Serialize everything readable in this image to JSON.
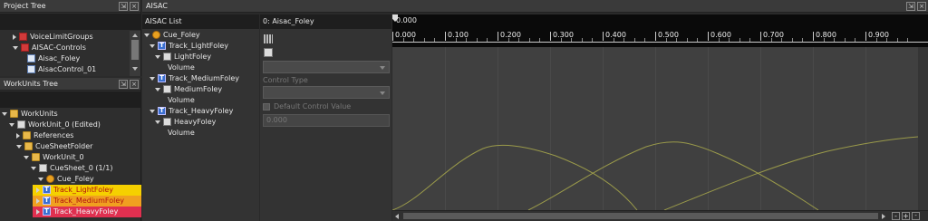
{
  "project_tree": {
    "title": "Project Tree",
    "items": [
      {
        "label": "VoiceLimitGroups"
      },
      {
        "label": "AISAC-Controls"
      },
      {
        "label": "Aisac_Foley"
      },
      {
        "label": "AisacControl_01"
      }
    ]
  },
  "workunits_tree": {
    "title": "WorkUnits Tree",
    "items": [
      {
        "label": "WorkUnits"
      },
      {
        "label": "WorkUnit_0 (Edited)"
      },
      {
        "label": "References"
      },
      {
        "label": "CueSheetFolder"
      },
      {
        "label": "WorkUnit_0"
      },
      {
        "label": "CueSheet_0 (1/1)"
      },
      {
        "label": "Cue_Foley"
      },
      {
        "label": "Track_LightFoley"
      },
      {
        "label": "Track_MediumFoley"
      },
      {
        "label": "Track_HeavyFoley"
      }
    ]
  },
  "aisac_panel": {
    "title": "AISAC",
    "list_title": "AISAC List",
    "list_items": [
      {
        "label": "Cue_Foley"
      },
      {
        "label": "Track_LightFoley"
      },
      {
        "label": "LightFoley"
      },
      {
        "label": "Volume"
      },
      {
        "label": "Track_MediumFoley"
      },
      {
        "label": "MediumFoley"
      },
      {
        "label": "Volume"
      },
      {
        "label": "Track_HeavyFoley"
      },
      {
        "label": "HeavyFoley"
      },
      {
        "label": "Volume"
      }
    ],
    "editor_title": "0: Aisac_Foley",
    "control_type_label": "Control Type",
    "default_control_label": "Default Control Value",
    "default_control_value": "0.000",
    "cursor_value": "0.000",
    "ticks": [
      "0.000",
      "0.100",
      "0.200",
      "0.300",
      "0.400",
      "0.500",
      "0.600",
      "0.700",
      "0.800",
      "0.900"
    ],
    "curve_color": "#9a9a4a"
  },
  "colors": {
    "light_foley_bg": "#f5d000",
    "medium_foley_bg": "#f0a020",
    "heavy_foley_bg": "#e03050",
    "selected_bg": "#4a5a78"
  }
}
